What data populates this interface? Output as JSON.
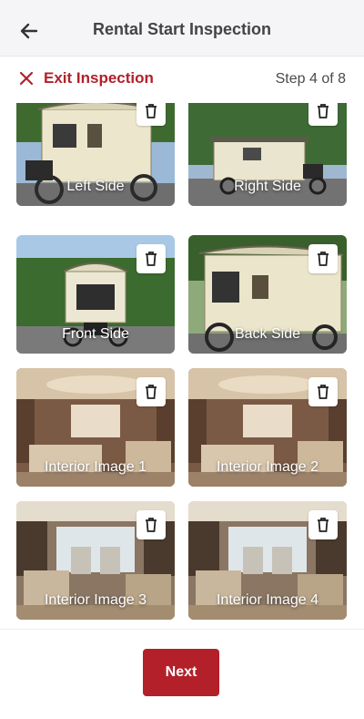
{
  "header": {
    "title": "Rental Start Inspection",
    "back_icon": "arrow-left-icon"
  },
  "subbar": {
    "exit_label": "Exit Inspection",
    "step_text": "Step 4 of 8",
    "accent_color": "#b3202a"
  },
  "images": [
    {
      "label": "Left Side",
      "kind": "exterior"
    },
    {
      "label": "Right Side",
      "kind": "exterior"
    },
    {
      "label": "Front Side",
      "kind": "exterior"
    },
    {
      "label": "Back Side",
      "kind": "exterior"
    },
    {
      "label": "Interior Image 1",
      "kind": "interior-living"
    },
    {
      "label": "Interior Image 2",
      "kind": "interior-living"
    },
    {
      "label": "Interior Image 3",
      "kind": "interior-cab"
    },
    {
      "label": "Interior Image 4",
      "kind": "interior-cab"
    }
  ],
  "footer": {
    "next_label": "Next"
  }
}
